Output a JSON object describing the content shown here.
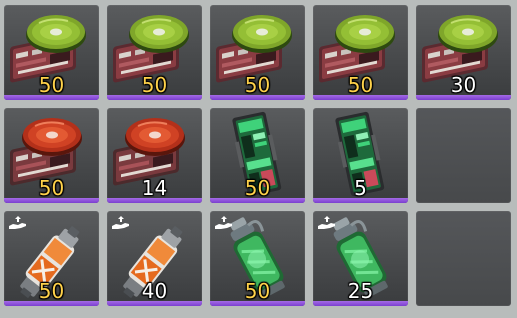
{
  "inventory": {
    "slots": [
      {
        "item": "green-disc-device",
        "qty": "50",
        "qty_color": "#ffd24a",
        "has_bar": true
      },
      {
        "item": "green-disc-device",
        "qty": "50",
        "qty_color": "#ffd24a",
        "has_bar": true
      },
      {
        "item": "green-disc-device",
        "qty": "50",
        "qty_color": "#ffd24a",
        "has_bar": true
      },
      {
        "item": "green-disc-device",
        "qty": "50",
        "qty_color": "#ffd24a",
        "has_bar": true
      },
      {
        "item": "green-disc-device",
        "qty": "30",
        "qty_color": "#ffffff",
        "has_bar": true
      },
      {
        "item": "red-disc-device",
        "qty": "50",
        "qty_color": "#ffd24a",
        "has_bar": true
      },
      {
        "item": "red-disc-device",
        "qty": "14",
        "qty_color": "#ffffff",
        "has_bar": true
      },
      {
        "item": "circuit-module",
        "qty": "50",
        "qty_color": "#ffd24a",
        "has_bar": true
      },
      {
        "item": "circuit-module",
        "qty": "5",
        "qty_color": "#ffffff",
        "has_bar": true
      },
      {
        "item": "empty",
        "qty": "",
        "qty_color": "#ffffff",
        "has_bar": false
      },
      {
        "item": "orange-canister",
        "qty": "50",
        "qty_color": "#ffd24a",
        "has_bar": true,
        "hand_icon": true
      },
      {
        "item": "orange-canister",
        "qty": "40",
        "qty_color": "#ffffff",
        "has_bar": true,
        "hand_icon": true
      },
      {
        "item": "green-grenade",
        "qty": "50",
        "qty_color": "#ffd24a",
        "has_bar": true,
        "hand_icon": true
      },
      {
        "item": "green-grenade",
        "qty": "25",
        "qty_color": "#ffffff",
        "has_bar": true,
        "hand_icon": true
      },
      {
        "item": "empty",
        "qty": "",
        "qty_color": "#ffffff",
        "has_bar": false
      }
    ]
  },
  "colors": {
    "full_stack": "#ffd24a",
    "partial_stack": "#ffffff",
    "rarity_bar": "#8e52dc"
  }
}
